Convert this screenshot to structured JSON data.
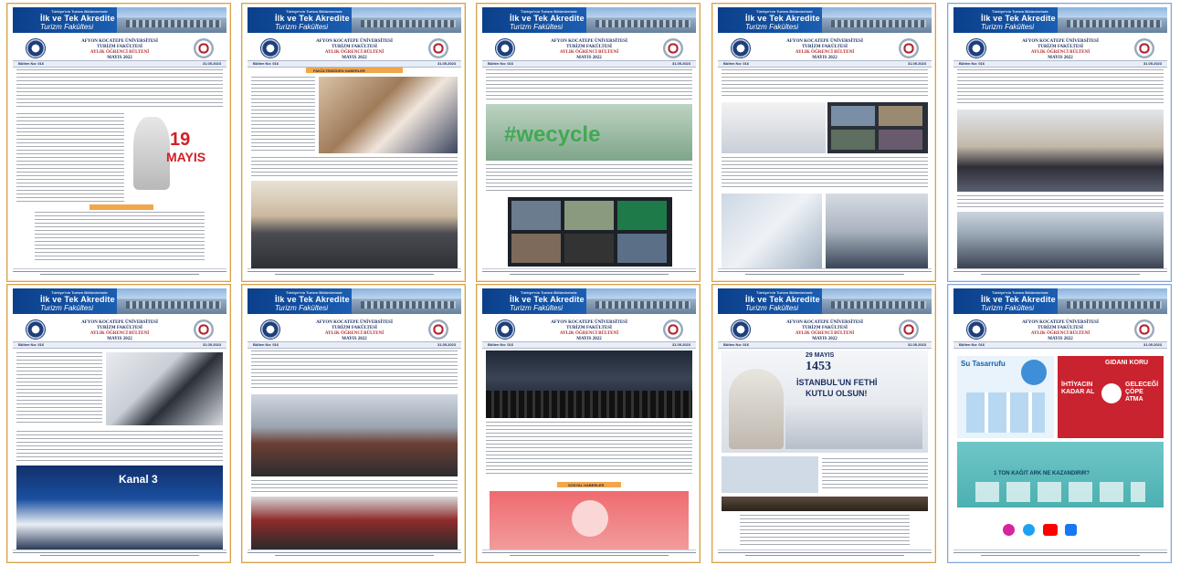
{
  "banner": {
    "subtitle": "Türkiye'nin Turizm Bölümlerinde",
    "line1": "İlk ve Tek Akredite",
    "line2": "Turizm Fakültesi"
  },
  "header": {
    "university": "AFYON KOCATEPE ÜNİVERSİTESİ",
    "faculty": "TURİZM FAKÜLTESİ",
    "bulletin": "AYLIK ÖĞRENCİ BÜLTENİ",
    "month": "MAYIS 2022"
  },
  "issue_bar": {
    "issue": "Bülten No: 016",
    "date": "31.05.2023"
  },
  "pages": [
    {
      "name": "page-1",
      "highlight": "19",
      "highlight2": "MAYIS"
    },
    {
      "name": "page-2",
      "section": "FAKÜLTEMİZDEN HABERLER"
    },
    {
      "name": "page-3",
      "image_word": "#wecycle"
    },
    {
      "name": "page-4"
    },
    {
      "name": "page-5"
    },
    {
      "name": "page-6"
    },
    {
      "name": "page-7"
    },
    {
      "name": "page-8",
      "section": "SOSYAL HABERLER"
    },
    {
      "name": "page-9",
      "date_badge": "29 MAYIS",
      "year": "1453",
      "title": "İSTANBUL'UN FETHİ",
      "title2": "KUTLU OLSUN!"
    },
    {
      "name": "page-10",
      "left_title": "Su Tasarrufu",
      "right_title": "GIDANI KORU",
      "q1": "İHTİYACIN KADAR AL",
      "q2": "GELECEĞİ ÇÖPE ATMA",
      "bottom": "1 TON KAĞIT ARK NE KAZANDIRIR?"
    }
  ],
  "footer": {
    "text": "AKÜ, Turizm Fakültesi, Ahmet Necdet Sezer Kampüsü Gazlıgöl Yolu, 3. Eğitim Binası, 03200, AFYONKARAHİSAR"
  }
}
